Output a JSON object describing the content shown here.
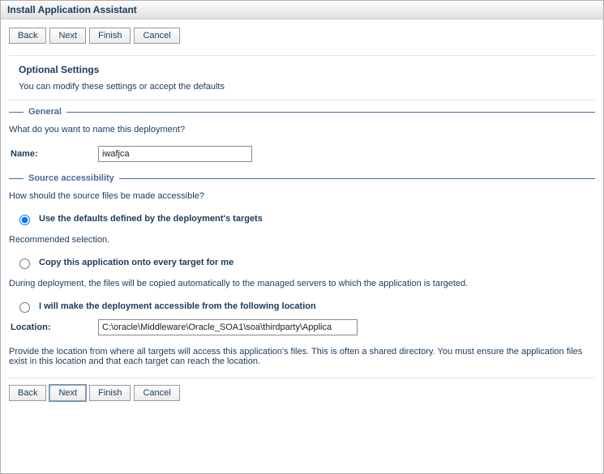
{
  "window": {
    "title": "Install Application Assistant"
  },
  "buttons": {
    "back": "Back",
    "next": "Next",
    "finish": "Finish",
    "cancel": "Cancel"
  },
  "optional": {
    "heading": "Optional Settings",
    "desc": "You can modify these settings or accept the defaults"
  },
  "general": {
    "legend": "General",
    "question": "What do you want to name this deployment?",
    "name_label": "Name:",
    "name_value": "iwafjca"
  },
  "source": {
    "legend": "Source accessibility",
    "question": "How should the source files be made accessible?",
    "opt_defaults": "Use the defaults defined by the deployment's targets",
    "helper_recommended": "Recommended selection.",
    "opt_copy": "Copy this application onto every target for me",
    "helper_copy": "During deployment, the files will be copied automatically to the managed servers to which the application is targeted.",
    "opt_location": "I will make the deployment accessible from the following location",
    "location_label": "Location:",
    "location_value": "C:\\oracle\\Middleware\\Oracle_SOA1\\soa\\thirdparty\\Applica",
    "helper_location": "Provide the location from where all targets will access this application's files. This is often a shared directory. You must ensure the application files exist in this location and that each target can reach the location."
  }
}
